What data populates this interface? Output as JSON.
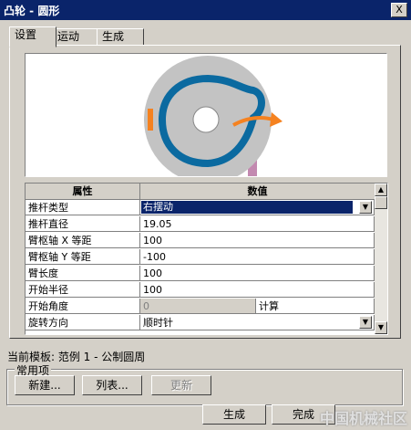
{
  "window": {
    "title": "凸轮 - 圆形",
    "close_label": "X"
  },
  "tabs": [
    {
      "label": "设置",
      "active": true
    },
    {
      "label": "运动",
      "active": false
    },
    {
      "label": "生成",
      "active": false
    }
  ],
  "grid": {
    "col_property": "属性",
    "col_value": "数值",
    "rows": [
      {
        "name": "推杆类型",
        "value": "右摆动",
        "type": "select"
      },
      {
        "name": "推杆直径",
        "value": "19.05"
      },
      {
        "name": "臂枢轴 X 等距",
        "value": "100"
      },
      {
        "name": "臂枢轴 Y 等距",
        "value": "-100"
      },
      {
        "name": "臂长度",
        "value": "100"
      },
      {
        "name": "开始半径",
        "value": "100"
      },
      {
        "name": "开始角度",
        "value": "0",
        "extra": "计算",
        "disabled": true
      },
      {
        "name": "旋转方向",
        "value": "顺时针",
        "type": "select"
      }
    ]
  },
  "status": {
    "template_text": "当前模板: 范例 1 - 公制圆周"
  },
  "common": {
    "legend": "常用项",
    "new_label": "新建...",
    "list_label": "列表...",
    "update_label": "更新"
  },
  "footer": {
    "generate_label": "生成",
    "done_label": "完成"
  },
  "watermark": "中国机械社区",
  "colors": {
    "accent": "#0a246a",
    "cam_ring": "#0b6aa0",
    "follower": "#f58220"
  },
  "icons": {
    "close": "close-icon",
    "dropdown": "chevron-down-icon",
    "scroll_up": "scroll-up-icon",
    "scroll_down": "scroll-down-icon"
  }
}
